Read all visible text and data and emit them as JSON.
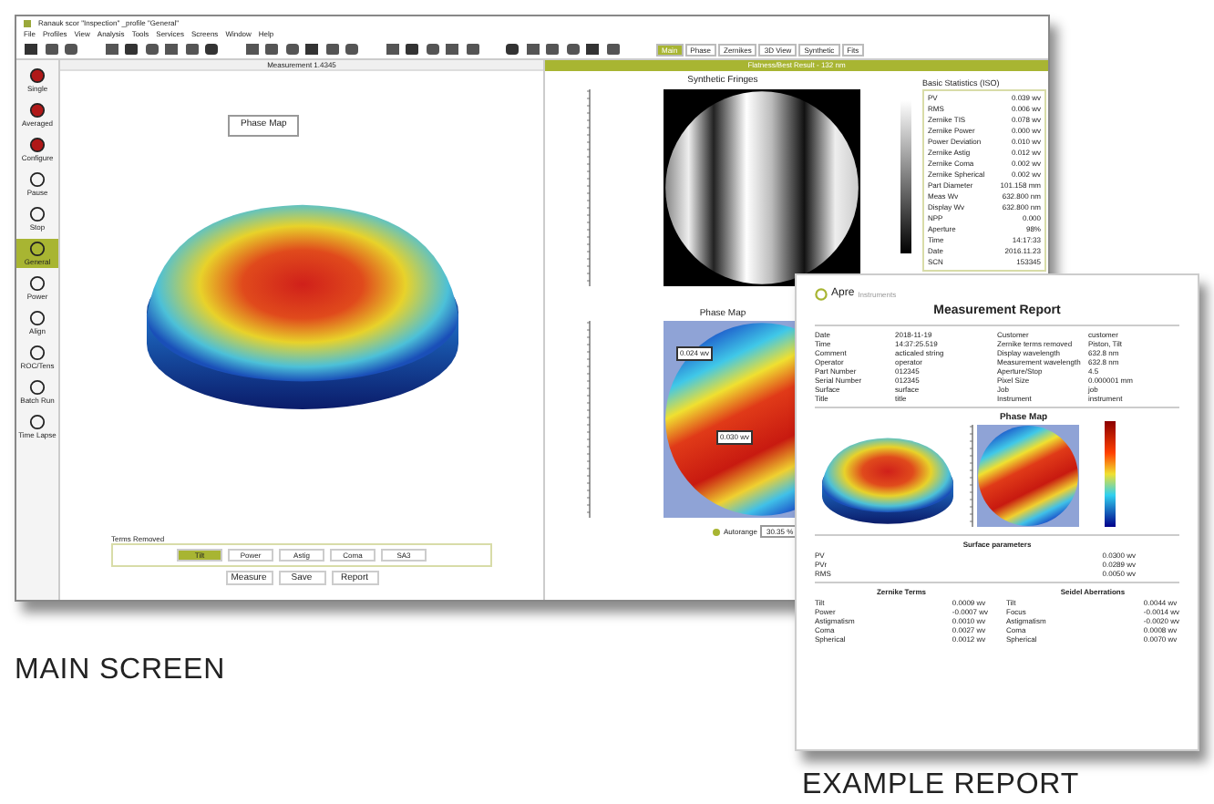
{
  "main_window": {
    "title": "Ranauk scor \"Inspection\" _profile \"General\"",
    "menu": [
      "File",
      "Profiles",
      "View",
      "Analysis",
      "Tools",
      "Services",
      "Screens",
      "Window",
      "Help"
    ],
    "tabs": [
      {
        "label": "Main",
        "selected": true
      },
      {
        "label": "Phase",
        "selected": false
      },
      {
        "label": "Zernikes",
        "selected": false
      },
      {
        "label": "3D View",
        "selected": false
      },
      {
        "label": "Synthetic",
        "selected": false
      },
      {
        "label": "Fits",
        "selected": false
      }
    ],
    "left_tools": [
      {
        "label": "Single",
        "selected": false
      },
      {
        "label": "Averaged",
        "selected": false
      },
      {
        "label": "Configure",
        "selected": false
      },
      {
        "label": "Pause",
        "selected": false
      },
      {
        "label": "Stop",
        "selected": false
      },
      {
        "label": "General",
        "selected": true
      },
      {
        "label": "Power",
        "selected": false
      },
      {
        "label": "Align",
        "selected": false
      },
      {
        "label": "ROC/Tens",
        "selected": false
      },
      {
        "label": "Batch Run",
        "selected": false
      },
      {
        "label": "Time Lapse",
        "selected": false
      }
    ],
    "left_panel": {
      "header": "Measurement 1.4345",
      "view_button": "Phase Map",
      "terms_label": "Terms Removed",
      "terms": [
        {
          "label": "Tilt",
          "selected": true
        },
        {
          "label": "Power",
          "selected": false
        },
        {
          "label": "Astig",
          "selected": false
        },
        {
          "label": "Coma",
          "selected": false
        },
        {
          "label": "SA3",
          "selected": false
        }
      ],
      "actions": [
        "Measure",
        "Save",
        "Report"
      ]
    },
    "right_panel": {
      "header": "Flatness/Best Result - 132 nm",
      "fringes_title": "Synthetic Fringes",
      "phase_title": "Phase Map",
      "phase_labels": [
        "0.024 wv",
        "0.030 wv"
      ],
      "autorange": {
        "label": "Autorange",
        "value": "30.35 %"
      },
      "stats": {
        "title": "Basic Statistics (ISO)",
        "rows": [
          {
            "label": "PV",
            "value": "0.039 wv"
          },
          {
            "label": "RMS",
            "value": "0.006 wv"
          },
          {
            "label": "Zernike TIS",
            "value": "0.078 wv"
          },
          {
            "label": "Zernike Power",
            "value": "0.000 wv"
          },
          {
            "label": "Power Deviation",
            "value": "0.010 wv"
          },
          {
            "label": "Zernike Astig",
            "value": "0.012 wv"
          },
          {
            "label": "Zernike Coma",
            "value": "0.002 wv"
          },
          {
            "label": "Zernike Spherical",
            "value": "0.002 wv"
          },
          {
            "label": "Part Diameter",
            "value": "101.158 mm"
          },
          {
            "label": "Meas Wv",
            "value": "632.800 nm"
          },
          {
            "label": "Display Wv",
            "value": "632.800 nm"
          },
          {
            "label": "NPP",
            "value": "0.000"
          },
          {
            "label": "Aperture",
            "value": "98%"
          },
          {
            "label": "Time",
            "value": "14:17:33"
          },
          {
            "label": "Date",
            "value": "2016.11.23"
          },
          {
            "label": "SCN",
            "value": "153345"
          }
        ]
      }
    }
  },
  "report": {
    "logo": "Apre",
    "logo_sub": "Instruments",
    "title": "Measurement Report",
    "info_left": [
      {
        "label": "Date",
        "value": "2018-11-19"
      },
      {
        "label": "Time",
        "value": "14:37:25.519"
      },
      {
        "label": "Comment",
        "value": "acticaled string"
      },
      {
        "label": "Operator",
        "value": "operator"
      },
      {
        "label": "Part Number",
        "value": "012345"
      },
      {
        "label": "Serial Number",
        "value": "012345"
      },
      {
        "label": "Surface",
        "value": "surface"
      },
      {
        "label": "Title",
        "value": "title"
      }
    ],
    "info_right": [
      {
        "label": "Customer",
        "value": "customer"
      },
      {
        "label": "Zernike terms removed",
        "value": "Piston, Tilt"
      },
      {
        "label": "Display wavelength",
        "value": "632.8 nm"
      },
      {
        "label": "Measurement wavelength",
        "value": "632.8 nm"
      },
      {
        "label": "Aperture/Stop",
        "value": "4.5"
      },
      {
        "label": "Pixel Size",
        "value": "0.000001 mm"
      },
      {
        "label": "Job",
        "value": "job"
      },
      {
        "label": "Instrument",
        "value": "instrument"
      }
    ],
    "figure_title": "Phase Map",
    "surface_title": "Surface parameters",
    "surface": [
      {
        "label": "PV",
        "value": "0.0300 wv"
      },
      {
        "label": "PVr",
        "value": "0.0289 wv"
      },
      {
        "label": "RMS",
        "value": "0.0050 wv"
      }
    ],
    "zernike_title": "Zernike Terms",
    "zernike": [
      {
        "label": "Tilt",
        "value": "0.0009 wv"
      },
      {
        "label": "Power",
        "value": "-0.0007 wv"
      },
      {
        "label": "Astigmatism",
        "value": "0.0010 wv"
      },
      {
        "label": "Coma",
        "value": "0.0027 wv"
      },
      {
        "label": "Spherical",
        "value": "0.0012 wv"
      }
    ],
    "seidel_title": "Seidel Aberrations",
    "seidel": [
      {
        "label": "Tilt",
        "value": "0.0044 wv"
      },
      {
        "label": "Focus",
        "value": "-0.0014 wv"
      },
      {
        "label": "Astigmatism",
        "value": "-0.0020 wv"
      },
      {
        "label": "Coma",
        "value": "0.0008 wv"
      },
      {
        "label": "Spherical",
        "value": "0.0070 wv"
      }
    ]
  },
  "captions": [
    "MAIN SCREEN",
    "EXAMPLE REPORT"
  ]
}
